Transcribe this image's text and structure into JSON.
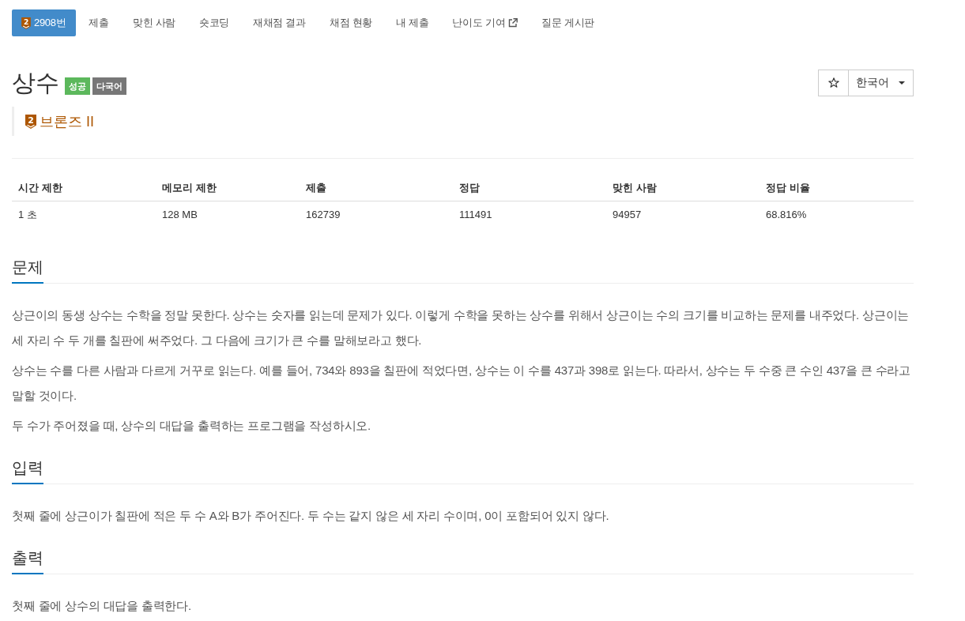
{
  "nav": {
    "tabs": [
      {
        "label": "2908번",
        "kind": "problem",
        "badge": "2",
        "selected": true
      },
      {
        "label": "제출",
        "kind": "link",
        "selected": false
      },
      {
        "label": "맞힌 사람",
        "kind": "link",
        "selected": false
      },
      {
        "label": "숏코딩",
        "kind": "link",
        "selected": false
      },
      {
        "label": "재채점 결과",
        "kind": "link",
        "selected": false
      },
      {
        "label": "채점 현황",
        "kind": "link",
        "selected": false
      },
      {
        "label": "내 제출",
        "kind": "link",
        "selected": false
      },
      {
        "label": "난이도 기여",
        "kind": "external",
        "selected": false
      },
      {
        "label": "질문 게시판",
        "kind": "link",
        "selected": false
      }
    ]
  },
  "problem": {
    "title": "상수",
    "labels": [
      {
        "text": "성공",
        "color": "#5cb85c"
      },
      {
        "text": "다국어",
        "color": "#777777"
      }
    ],
    "tier": {
      "badge": "2",
      "name": "브론즈 II"
    },
    "language": {
      "label": "한국어"
    }
  },
  "table": {
    "columns": [
      "시간 제한",
      "메모리 제한",
      "제출",
      "정답",
      "맞힌 사람",
      "정답 비율"
    ],
    "rows": [
      [
        "1 초",
        "128 MB",
        "162739",
        "111491",
        "94957",
        "68.816%"
      ]
    ]
  },
  "sections": [
    {
      "heading": "문제",
      "paragraphs": [
        "상근이의 동생 상수는 수학을 정말 못한다. 상수는 숫자를 읽는데 문제가 있다. 이렇게 수학을 못하는 상수를 위해서 상근이는 수의 크기를 비교하는 문제를 내주었다. 상근이는 세 자리 수 두 개를 칠판에 써주었다. 그 다음에 크기가 큰 수를 말해보라고 했다.",
        "상수는 수를 다른 사람과 다르게 거꾸로 읽는다. 예를 들어, 734와 893을 칠판에 적었다면, 상수는 이 수를 437과 398로 읽는다. 따라서, 상수는 두 수중 큰 수인 437을 큰 수라고 말할 것이다.",
        "두 수가 주어졌을 때, 상수의 대답을 출력하는 프로그램을 작성하시오."
      ]
    },
    {
      "heading": "입력",
      "paragraphs": [
        "첫째 줄에 상근이가 칠판에 적은 두 수 A와 B가 주어진다. 두 수는 같지 않은 세 자리 수이며, 0이 포함되어 있지 않다."
      ]
    },
    {
      "heading": "출력",
      "paragraphs": [
        "첫째 줄에 상수의 대답을 출력한다."
      ]
    }
  ]
}
